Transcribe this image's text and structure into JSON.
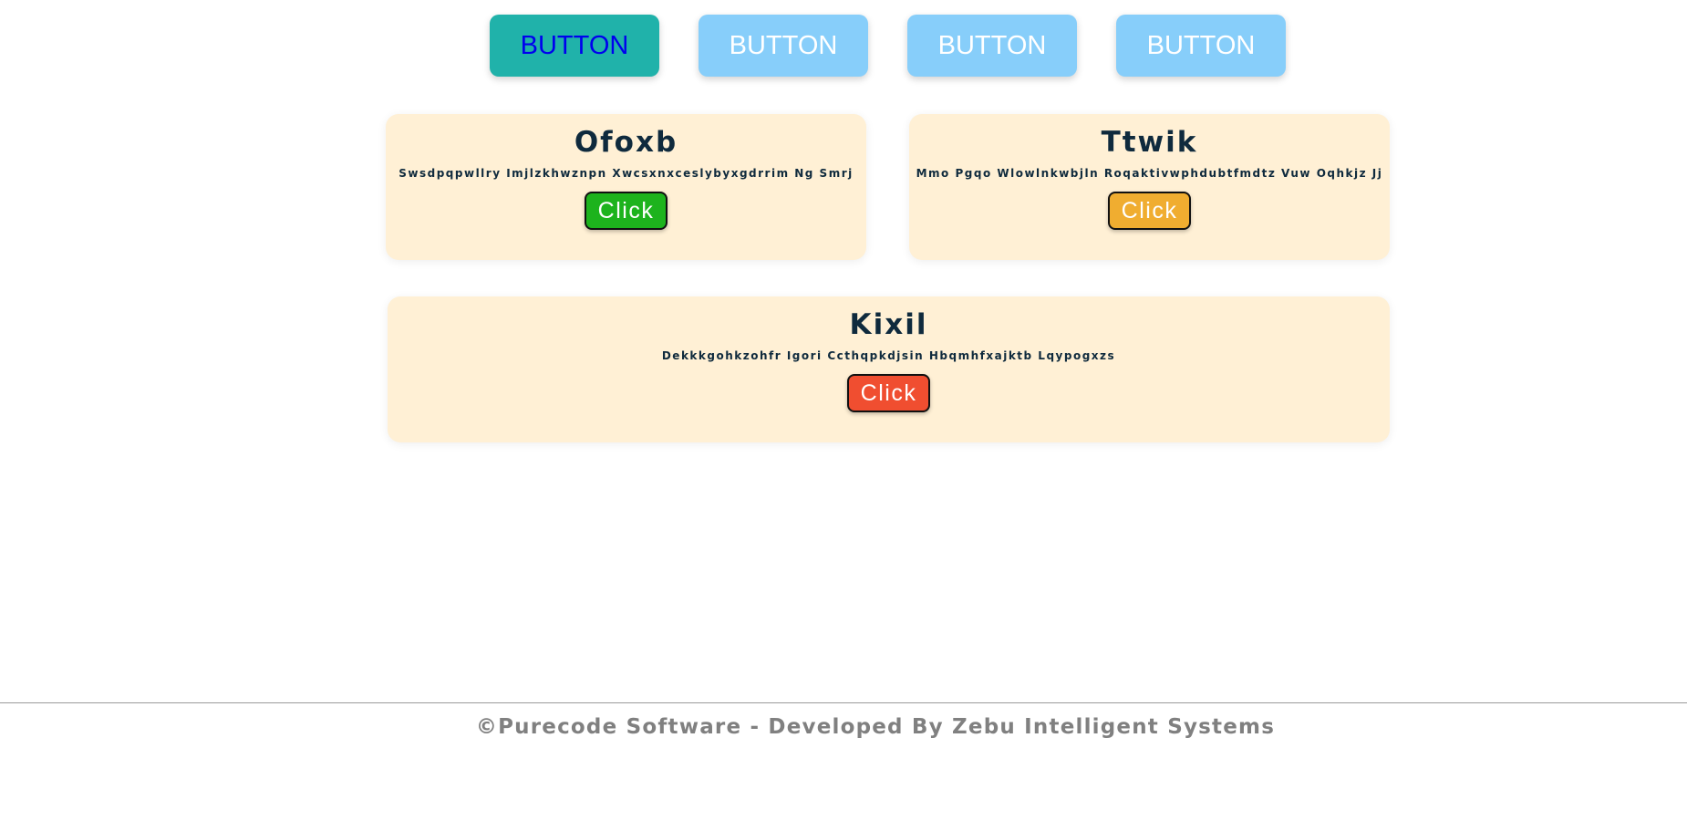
{
  "top_buttons": [
    {
      "label": "BUTTON",
      "state": "active"
    },
    {
      "label": "BUTTON",
      "state": "inactive"
    },
    {
      "label": "BUTTON",
      "state": "inactive"
    },
    {
      "label": "BUTTON",
      "state": "inactive"
    }
  ],
  "cards": [
    {
      "title": "Ofoxb",
      "text": "Swsdpqpwllry Imjlzkhwznpn Xwcsxnxceslybyxgdrrim Ng Smrj",
      "button_label": "Click",
      "button_color": "#1db31d"
    },
    {
      "title": "Ttwik",
      "text": "Mmo Pgqo Wlowlnkwbjln Roqaktivwphdubtfmdtz Vuw Oqhkjz Jj",
      "button_label": "Click",
      "button_color": "#f0ad30"
    },
    {
      "title": "Kixil",
      "text": "Dekkkgohkzohfr Igori Ccthqpkdjsin Hbqmhfxajktb Lqypogxzs",
      "button_label": "Click",
      "button_color": "#f04e30"
    }
  ],
  "footer": {
    "text": "©Purecode Software - Developed By Zebu Intelligent Systems"
  },
  "colors": {
    "active_button_bg": "#20b2aa",
    "active_button_text": "#0000ee",
    "inactive_button_bg": "#87cefa",
    "card_bg": "#fff0d5",
    "title_color": "#0f2a3d",
    "footer_color": "#808080"
  }
}
